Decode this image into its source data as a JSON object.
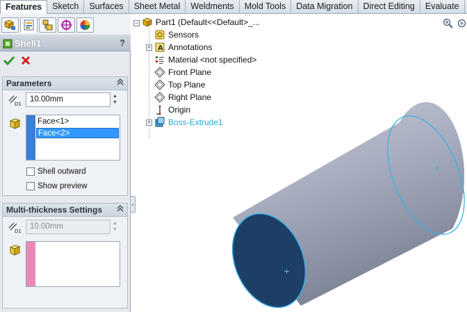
{
  "ribbon": {
    "tabs": [
      {
        "label": "Features",
        "active": true
      },
      {
        "label": "Sketch"
      },
      {
        "label": "Surfaces"
      },
      {
        "label": "Sheet Metal"
      },
      {
        "label": "Weldments"
      },
      {
        "label": "Mold Tools"
      },
      {
        "label": "Data Migration"
      },
      {
        "label": "Direct Editing"
      },
      {
        "label": "Evaluate"
      }
    ]
  },
  "property_manager": {
    "toolbar_icons": [
      "feature-manager-icon",
      "property-manager-icon",
      "configuration-manager-icon",
      "dimxpert-icon",
      "display-manager-icon"
    ],
    "title": "Shell1",
    "help_label": "?",
    "ok_icon": "checkmark-icon",
    "cancel_icon": "red-x-icon",
    "parameters": {
      "header": "Parameters",
      "thickness_value": "10.00mm",
      "faces": [
        "Face<1>",
        "Face<2>"
      ],
      "selected_face_index": 1,
      "shell_outward_label": "Shell outward",
      "shell_outward_checked": false,
      "show_preview_label": "Show preview",
      "show_preview_checked": false,
      "list_color": "#3a7fd6"
    },
    "multi_thickness": {
      "header": "Multi-thickness Settings",
      "thickness_value": "10.00mm",
      "list_color": "#e889b8"
    }
  },
  "feature_tree": {
    "root": "Part1  (Default<<Default>_...",
    "items": [
      {
        "label": "Sensors",
        "icon": "sensors-icon",
        "expandable": false
      },
      {
        "label": "Annotations",
        "icon": "annotations-icon",
        "expandable": true
      },
      {
        "label": "Material <not specified>",
        "icon": "material-icon",
        "expandable": false
      },
      {
        "label": "Front Plane",
        "icon": "plane-icon",
        "expandable": false
      },
      {
        "label": "Top Plane",
        "icon": "plane-icon",
        "expandable": false
      },
      {
        "label": "Right Plane",
        "icon": "plane-icon",
        "expandable": false
      },
      {
        "label": "Origin",
        "icon": "origin-icon",
        "expandable": false
      },
      {
        "label": "Boss-Extrude1",
        "icon": "boss-extrude-icon",
        "expandable": true,
        "highlighted": true
      }
    ]
  },
  "view_tools": [
    "zoom-to-fit-icon",
    "rotate-view-icon"
  ],
  "model": {
    "shape": "cylinder",
    "body_color": "#aeb4c5",
    "selected_face_color": "#1d3f66",
    "edge_highlight_color": "#3ab0e6"
  }
}
